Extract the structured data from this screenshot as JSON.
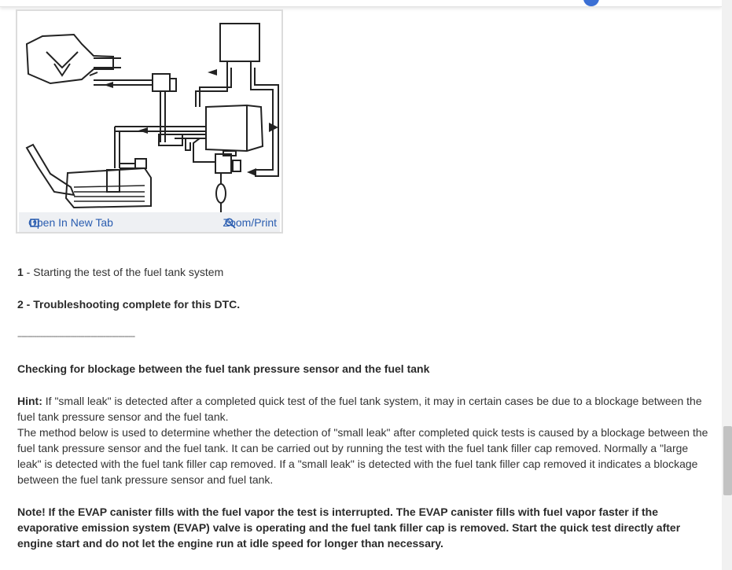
{
  "figure": {
    "open_link_label": "Open In New Tab",
    "zoom_link_label": "Zoom/Print"
  },
  "steps": [
    {
      "num": "1",
      "text": " - Starting the test of the fuel tank system"
    },
    {
      "num": "2",
      "text": " - Troubleshooting complete for this DTC."
    }
  ],
  "separator": "--------------------------------------------------------",
  "section_heading": "Checking for blockage between the fuel tank pressure sensor and the fuel tank",
  "hint": {
    "label": "Hint:",
    "text": " If \"small leak\" is detected after a completed quick test of the fuel tank system, it may in certain cases be due to a blockage between the fuel tank pressure sensor and the fuel tank.",
    "text2": "The method below is used to determine whether the detection of \"small leak\" after completed quick tests is caused by a blockage between the fuel tank pressure sensor and the fuel tank. It can be carried out by running the test with the fuel tank filler cap removed. Normally a \"large leak\" is detected with the fuel tank filler cap removed. If a \"small leak\" is detected with the fuel tank filler cap removed it indicates a blockage between the fuel tank pressure sensor and fuel tank."
  },
  "note": "Note! If the EVAP canister fills with the fuel vapor the test is interrupted. The EVAP canister fills with fuel vapor faster if the evaporative emission system (EVAP) valve is operating and the fuel tank filler cap is removed. Start the quick test directly after engine start and do not let the engine run at idle speed for longer than necessary.",
  "colors": {
    "link": "#2a5db0",
    "text": "#333333",
    "scrollbar_thumb": "#c2c2c2"
  },
  "icons": {
    "open_link": "new-tab-icon",
    "zoom_link": "magnifier-plus-icon"
  }
}
